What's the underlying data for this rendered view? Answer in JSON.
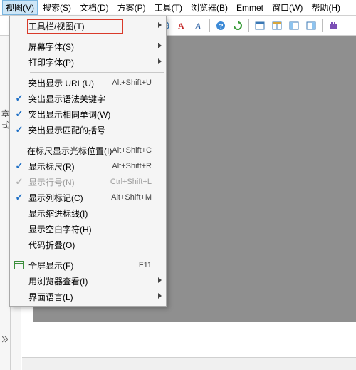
{
  "menubar": {
    "items": [
      {
        "label": "视图(V)",
        "active": true
      },
      {
        "label": "搜索(S)"
      },
      {
        "label": "文档(D)"
      },
      {
        "label": "方案(P)"
      },
      {
        "label": "工具(T)"
      },
      {
        "label": "浏览器(B)"
      },
      {
        "label": "Emmet"
      },
      {
        "label": "窗口(W)"
      },
      {
        "label": "帮助(H)"
      }
    ]
  },
  "toolbar": {
    "icons": [
      "globe-icon",
      "font-color-icon",
      "bold-icon",
      "sep",
      "help-icon",
      "refresh-icon",
      "sep",
      "layout-window-icon",
      "layout-split-icon",
      "layout-left-icon",
      "layout-right-icon",
      "sep",
      "plugin-icon"
    ]
  },
  "dropdown": {
    "items": [
      {
        "label": "工具栏/视图(T)",
        "submenu": true,
        "highlight": true
      },
      {
        "sep": true
      },
      {
        "label": "屏幕字体(S)",
        "submenu": true
      },
      {
        "label": "打印字体(P)",
        "submenu": true
      },
      {
        "sep": true
      },
      {
        "label": "突出显示 URL(U)",
        "shortcut": "Alt+Shift+U"
      },
      {
        "label": "突出显示语法关键字",
        "checked": true
      },
      {
        "label": "突出显示相同单词(W)",
        "checked": true
      },
      {
        "label": "突出显示匹配的括号",
        "checked": true
      },
      {
        "sep": true
      },
      {
        "label": "在标尺显示光标位置(I)",
        "shortcut": "Alt+Shift+C"
      },
      {
        "label": "显示标尺(R)",
        "shortcut": "Alt+Shift+R",
        "checked": true
      },
      {
        "label": "显示行号(N)",
        "shortcut": "Ctrl+Shift+L",
        "checked": true,
        "disabled": true
      },
      {
        "label": "显示列标记(C)",
        "shortcut": "Alt+Shift+M",
        "checked": true
      },
      {
        "label": "显示缩进标线(I)"
      },
      {
        "label": "显示空白字符(H)"
      },
      {
        "label": "代码折叠(O)"
      },
      {
        "sep": true
      },
      {
        "label": "全屏显示(F)",
        "shortcut": "F11",
        "icon": "fullscreen"
      },
      {
        "label": "用浏览器查看(I)",
        "submenu": true
      },
      {
        "label": "界面语言(L)",
        "submenu": true
      }
    ]
  },
  "gutter": {
    "char1": "章",
    "char2": "式"
  }
}
